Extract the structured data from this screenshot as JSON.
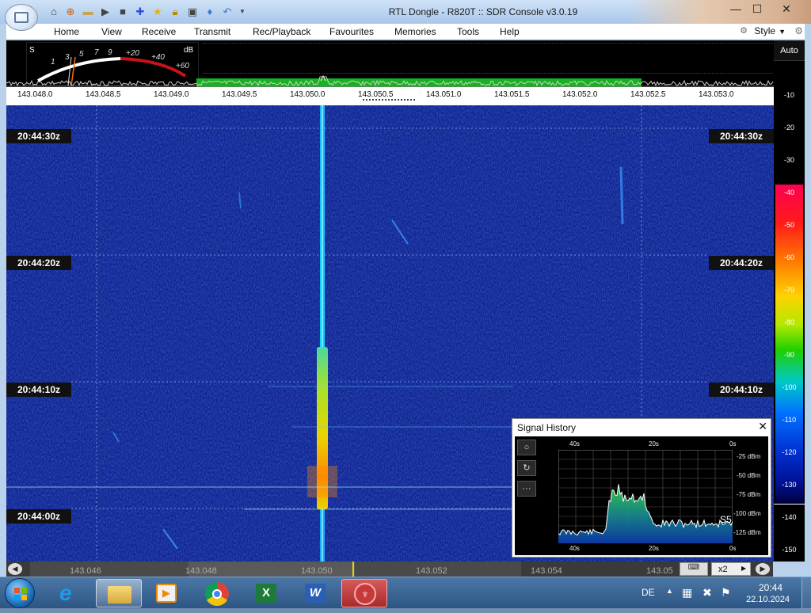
{
  "window": {
    "title": "RTL Dongle - R820T :: SDR Console v3.0.19",
    "controls": {
      "minimize": "—",
      "maximize": "☐",
      "close": "✕"
    }
  },
  "menu": {
    "items": [
      "Home",
      "View",
      "Receive",
      "Transmit",
      "Rec/Playback",
      "Favourites",
      "Memories",
      "Tools",
      "Help"
    ],
    "style_label": "Style"
  },
  "smeter": {
    "s_label": "S",
    "db_label": "dB",
    "ticks": [
      "1",
      "3",
      "5",
      "7",
      "9",
      "+20",
      "+40",
      "+60"
    ]
  },
  "frequency_ruler": [
    "143.048.0",
    "143.048.5",
    "143.049.0",
    "143.049.5",
    "143.050.0",
    "143.050.5",
    "143.051.0",
    "143.051.5",
    "143.052.0",
    "143.052.5",
    "143.053.0"
  ],
  "waterfall": {
    "time_labels": [
      "20:44:30z",
      "20:44:20z",
      "20:44:10z",
      "20:44:00z"
    ]
  },
  "db_scale": {
    "auto_label": "Auto",
    "levels": [
      "-10",
      "-20",
      "-30",
      "-40",
      "-50",
      "-60",
      "-70",
      "-80",
      "-90",
      "-100",
      "-110",
      "-120",
      "-130",
      "-140",
      "-150"
    ]
  },
  "signal_history": {
    "title": "Signal History",
    "close": "✕",
    "time_top": [
      "40s",
      "20s",
      "0s"
    ],
    "time_bottom": [
      "40s",
      "20s",
      "0s"
    ],
    "levels": [
      "-25 dBm",
      "-50 dBm",
      "-75 dBm",
      "-100 dBm",
      "-125 dBm"
    ],
    "s_reading": "S5",
    "tools": [
      "○",
      "↻",
      "···"
    ]
  },
  "bottom_bar": {
    "freqs": [
      "143.046",
      "143.048",
      "143.050",
      "143.052",
      "143.054",
      "143.05"
    ],
    "zoom": "x2"
  },
  "taskbar": {
    "language": "DE",
    "time": "20:44",
    "date": "22.10.2024"
  }
}
